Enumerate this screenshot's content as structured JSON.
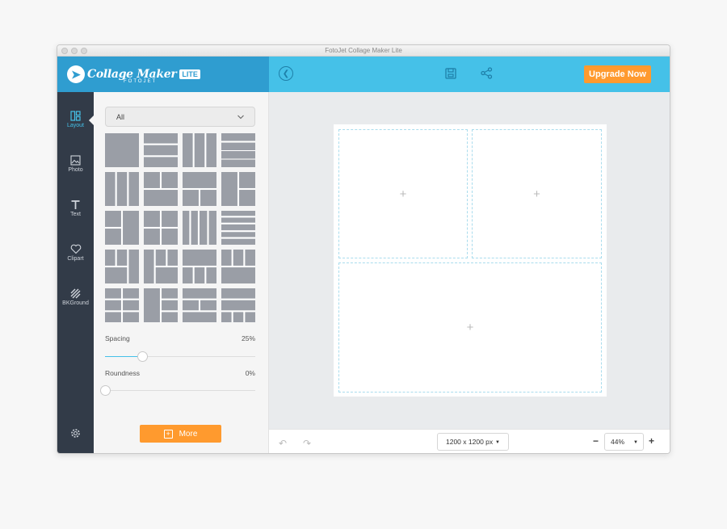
{
  "window": {
    "title": "FotoJet Collage Maker Lite"
  },
  "logo": {
    "text": "Collage Maker",
    "badge": "LITE",
    "sub": "FOTOJET"
  },
  "toolbar": {
    "upgrade_label": "Upgrade Now"
  },
  "rail": {
    "items": [
      {
        "label": "Layout",
        "icon": "layout-icon",
        "active": true
      },
      {
        "label": "Photo",
        "icon": "photo-icon"
      },
      {
        "label": "Text",
        "icon": "text-icon"
      },
      {
        "label": "Clipart",
        "icon": "heart-icon"
      },
      {
        "label": "BKGround",
        "icon": "background-icon"
      }
    ]
  },
  "panel": {
    "filter_value": "All",
    "spacing": {
      "label": "Spacing",
      "value": "25%"
    },
    "roundness": {
      "label": "Roundness",
      "value": "0%"
    },
    "more_label": "More"
  },
  "bottom": {
    "canvas_size": "1200 x 1200 px",
    "zoom": "44%"
  },
  "colors": {
    "header_dark": "#2f9dd0",
    "header_light": "#45c1e8",
    "accent_orange": "#ff9a2e",
    "rail": "#323b48"
  }
}
